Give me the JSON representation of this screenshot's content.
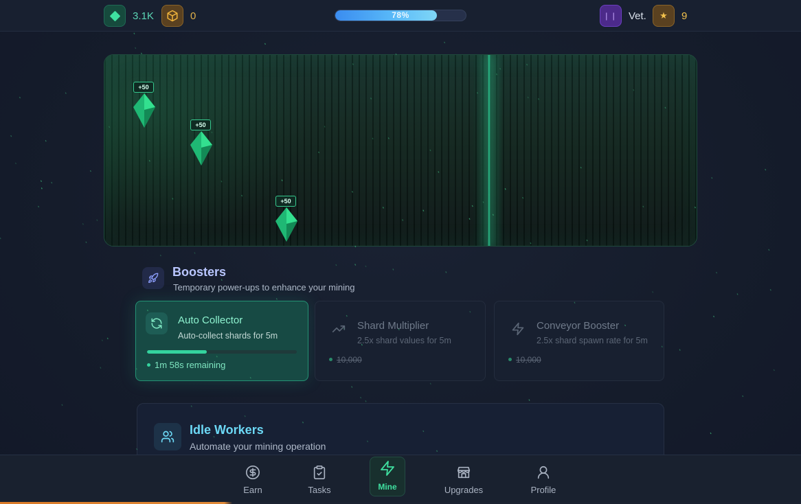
{
  "header": {
    "shards": {
      "value": "3.1K",
      "icon": "gem-icon"
    },
    "crates": {
      "value": "0",
      "icon": "crate-icon"
    },
    "progress": {
      "label": "78%",
      "percent": 78
    },
    "rank": {
      "label": "Vet.",
      "icon": "rank-badge-icon"
    },
    "level": {
      "value": "9",
      "icon": "star-icon"
    }
  },
  "mine": {
    "shard_drops": [
      {
        "badge": "+50"
      },
      {
        "badge": "+50"
      },
      {
        "badge": "+50"
      }
    ]
  },
  "boosters": {
    "title": "Boosters",
    "subtitle": "Temporary power-ups to enhance your mining",
    "icon": "rocket-icon",
    "cards": [
      {
        "name": "Auto Collector",
        "description": "Auto-collect shards for 5m",
        "progress": 0.4,
        "remaining": "1m 58s remaining",
        "icon": "refresh-icon",
        "active": true
      },
      {
        "name": "Shard Multiplier",
        "description": "2.5x shard values for 5m",
        "cost": "10,000",
        "icon": "trending-up-icon",
        "active": false
      },
      {
        "name": "Conveyor Booster",
        "description": "2.5x shard spawn rate for 5m",
        "cost": "10,000",
        "icon": "lightning-icon",
        "active": false
      }
    ]
  },
  "workers": {
    "title": "Idle Workers",
    "subtitle": "Automate your mining operation",
    "icon": "users-icon"
  },
  "nav": {
    "items": [
      {
        "label": "Earn",
        "icon": "dollar-icon"
      },
      {
        "label": "Tasks",
        "icon": "clipboard-icon"
      },
      {
        "label": "Mine",
        "icon": "lightning-icon",
        "active": true
      },
      {
        "label": "Upgrades",
        "icon": "store-icon"
      },
      {
        "label": "Profile",
        "icon": "user-icon"
      }
    ]
  },
  "colors": {
    "accent": "#3fe0a0",
    "progress": "#58b8f8",
    "gold": "#f2c14c"
  }
}
